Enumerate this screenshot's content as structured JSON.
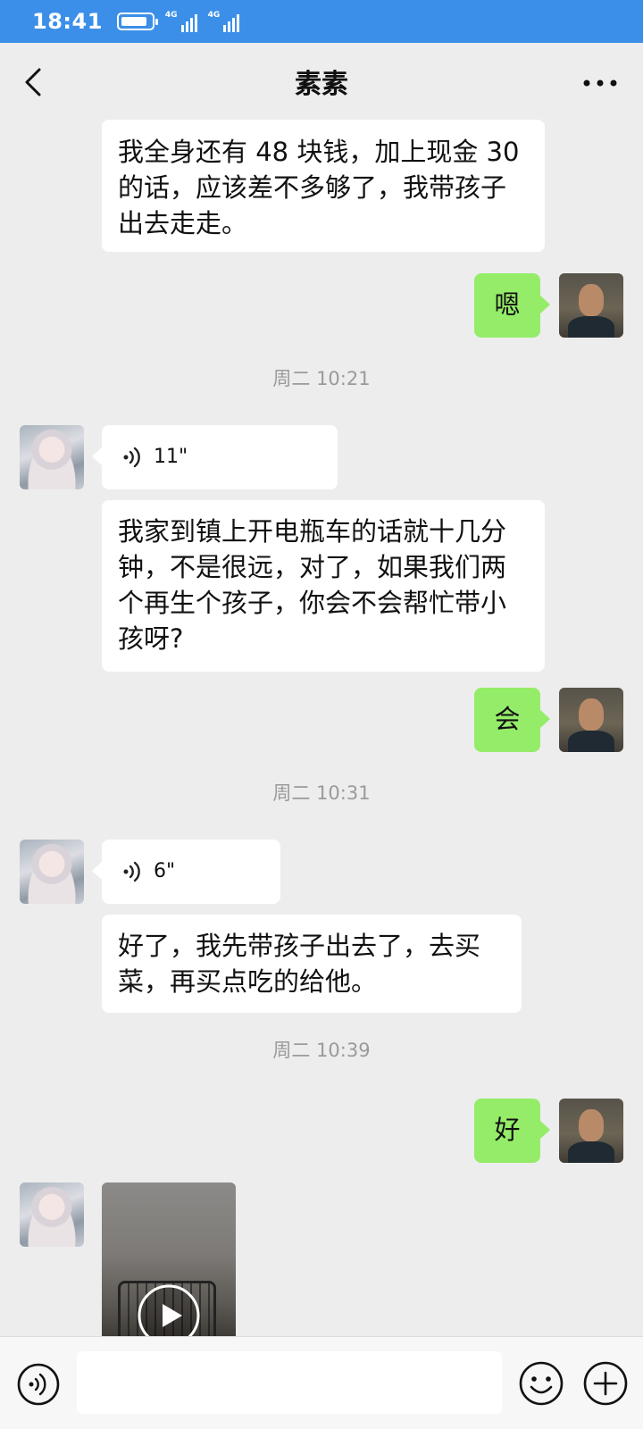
{
  "status_bar": {
    "time": "18:41",
    "network_1": "4G",
    "network_2": "4G"
  },
  "header": {
    "title": "素素",
    "back_icon": "chevron-left-icon",
    "more_icon": "more-horizontal-icon"
  },
  "messages": [
    {
      "sender": "other",
      "type": "text",
      "text": "我全身还有 48 块钱，加上现金 30 的话，应该差不多够了，我带孩子出去走走。"
    },
    {
      "sender": "self",
      "type": "text",
      "text": "嗯"
    },
    {
      "type": "time",
      "text": "周二 10:21"
    },
    {
      "sender": "other",
      "type": "voice",
      "duration": "11\""
    },
    {
      "sender": "other",
      "type": "text",
      "text": "我家到镇上开电瓶车的话就十几分钟，不是很远，对了，如果我们两个再生个孩子，你会不会帮忙带小孩呀?"
    },
    {
      "sender": "self",
      "type": "text",
      "text": "会"
    },
    {
      "type": "time",
      "text": "周二 10:31"
    },
    {
      "sender": "other",
      "type": "voice",
      "duration": "6\""
    },
    {
      "sender": "other",
      "type": "text",
      "text": "好了，我先带孩子出去了，去买菜，再买点吃的给他。"
    },
    {
      "type": "time",
      "text": "周二 10:39"
    },
    {
      "sender": "self",
      "type": "text",
      "text": "好"
    },
    {
      "sender": "other",
      "type": "video"
    }
  ],
  "input_bar": {
    "voice_icon": "voice-mode-icon",
    "message_value": "",
    "emoji_icon": "emoji-icon",
    "plus_icon": "plus-icon"
  },
  "colors": {
    "status_bar": "#3b8fe8",
    "self_bubble": "#95ec69",
    "other_bubble": "#ffffff",
    "background": "#ededed"
  }
}
